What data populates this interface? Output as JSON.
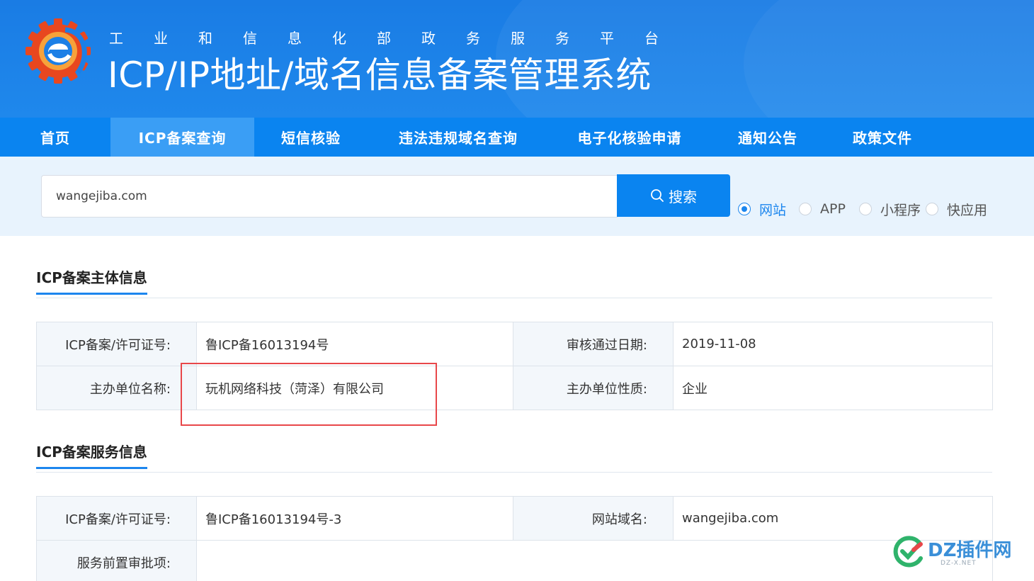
{
  "header": {
    "subtitle_chars": [
      "工",
      "业",
      "和",
      "信",
      "息",
      "化",
      "部",
      "政",
      "务",
      "服",
      "务",
      "平",
      "台"
    ],
    "title": "ICP/IP地址/域名信息备案管理系统"
  },
  "nav": {
    "items": [
      {
        "label": "首页",
        "active": false
      },
      {
        "label": "ICP备案查询",
        "active": true
      },
      {
        "label": "短信核验",
        "active": false
      },
      {
        "label": "违法违规域名查询",
        "active": false
      },
      {
        "label": "电子化核验申请",
        "active": false
      },
      {
        "label": "通知公告",
        "active": false
      },
      {
        "label": "政策文件",
        "active": false
      }
    ]
  },
  "search": {
    "value": "wangejiba.com",
    "button_label": "搜索",
    "options": [
      {
        "label": "网站",
        "checked": true
      },
      {
        "label": "APP",
        "checked": false
      },
      {
        "label": "小程序",
        "checked": false
      },
      {
        "label": "快应用",
        "checked": false
      }
    ]
  },
  "subject_section": {
    "title": "ICP备案主体信息",
    "rows": [
      {
        "label1": "ICP备案/许可证号:",
        "value1": "鲁ICP备16013194号",
        "label2": "审核通过日期:",
        "value2": "2019-11-08"
      },
      {
        "label1": "主办单位名称:",
        "value1": "玩机网络科技（菏泽）有限公司",
        "label2": "主办单位性质:",
        "value2": "企业"
      }
    ]
  },
  "service_section": {
    "title": "ICP备案服务信息",
    "rows": [
      {
        "label1": "ICP备案/许可证号:",
        "value1": "鲁ICP备16013194号-3",
        "label2": "网站域名:",
        "value2": "wangejiba.com"
      },
      {
        "label1": "服务前置审批项:",
        "value1": ""
      }
    ]
  },
  "watermark": {
    "text": "DZ插件网",
    "sub": "DZ-X.NET"
  },
  "colors": {
    "brand_blue": "#0a84f0",
    "highlight_red": "#e8474a"
  }
}
